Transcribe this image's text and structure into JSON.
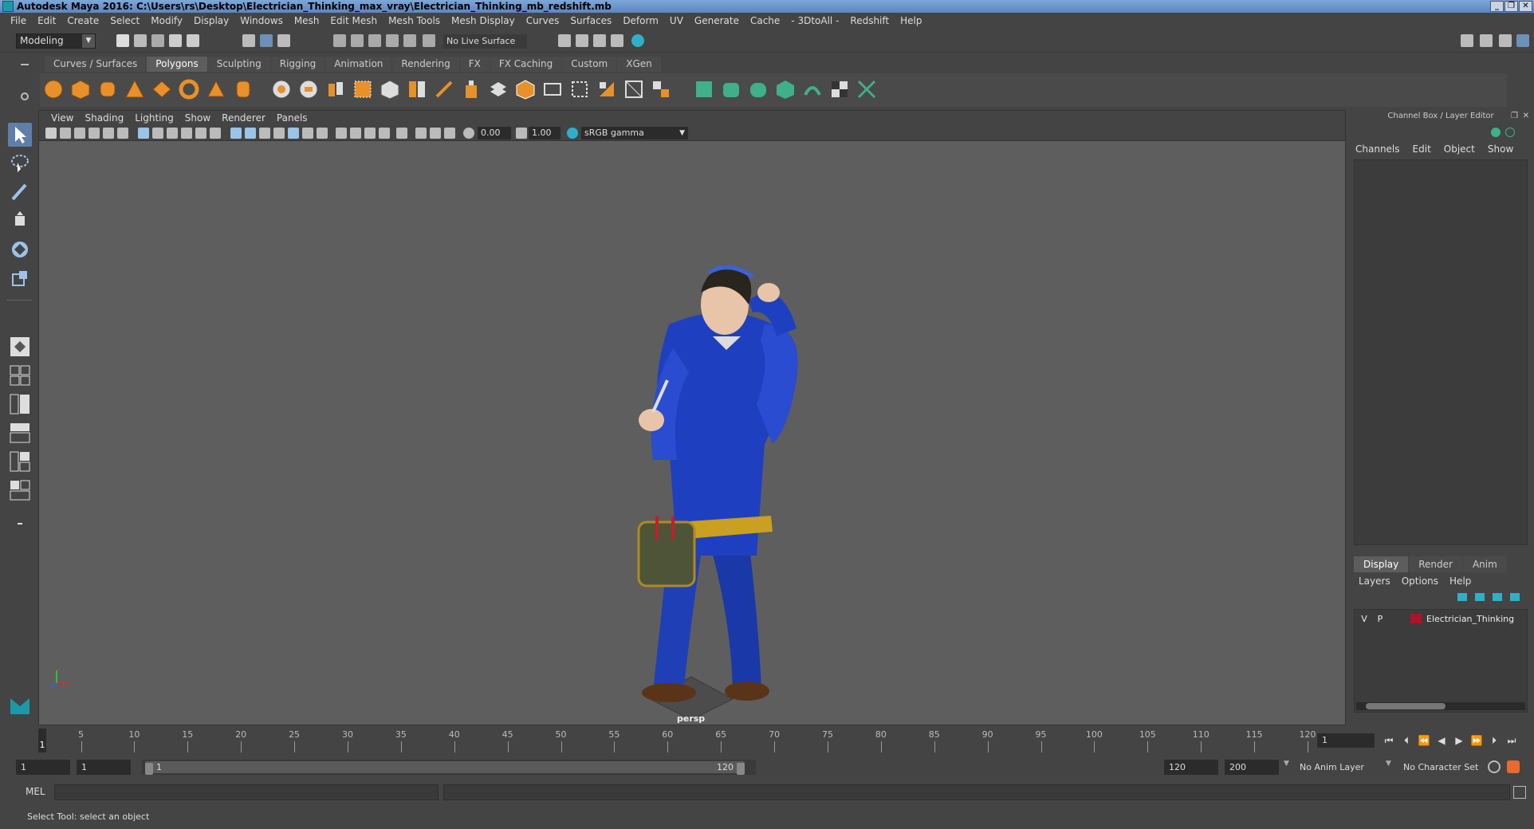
{
  "window": {
    "title": "Autodesk Maya 2016: C:\\Users\\rs\\Desktop\\Electrician_Thinking_max_vray\\Electrician_Thinking_mb_redshift.mb",
    "controls": [
      "_",
      "❐",
      "✕"
    ]
  },
  "menubar": [
    "File",
    "Edit",
    "Create",
    "Select",
    "Modify",
    "Display",
    "Windows",
    "Mesh",
    "Edit Mesh",
    "Mesh Tools",
    "Mesh Display",
    "Curves",
    "Surfaces",
    "Deform",
    "UV",
    "Generate",
    "Cache",
    "- 3DtoAll -",
    "Redshift",
    "Help"
  ],
  "statusline": {
    "mode": "Modeling",
    "live_surface": "No Live Surface"
  },
  "shelf": {
    "tabs": [
      "Curves / Surfaces",
      "Polygons",
      "Sculpting",
      "Rigging",
      "Animation",
      "Rendering",
      "FX",
      "FX Caching",
      "Custom",
      "XGen"
    ],
    "active_tab": "Polygons",
    "colors": {
      "primitive": "#e8902a",
      "tool": "#3eb08a"
    }
  },
  "viewport": {
    "menu": [
      "View",
      "Shading",
      "Lighting",
      "Show",
      "Renderer",
      "Panels"
    ],
    "exposure": "0.00",
    "gamma": "1.00",
    "colorspace": "sRGB gamma",
    "camera": "persp"
  },
  "channel_box": {
    "title": "Channel Box / Layer Editor",
    "menu": [
      "Channels",
      "Edit",
      "Object",
      "Show"
    ]
  },
  "layer_editor": {
    "tabs": [
      "Display",
      "Render",
      "Anim"
    ],
    "active_tab": "Display",
    "menu": [
      "Layers",
      "Options",
      "Help"
    ],
    "layers": [
      {
        "v": "V",
        "p": "P",
        "name": "Electrician_Thinking",
        "color": "#b0122a"
      }
    ]
  },
  "timeline": {
    "ticks": [
      "1",
      "5",
      "10",
      "15",
      "20",
      "25",
      "30",
      "35",
      "40",
      "45",
      "50",
      "55",
      "60",
      "65",
      "70",
      "75",
      "80",
      "85",
      "90",
      "95",
      "100",
      "105",
      "110",
      "115",
      "120"
    ],
    "current_frame": "1"
  },
  "range": {
    "start": "1",
    "playback_start": "1",
    "slider_start": "1",
    "slider_end": "120",
    "playback_end": "120",
    "end": "200",
    "anim_layer": "No Anim Layer",
    "character_set": "No Character Set"
  },
  "command_line": {
    "label": "MEL"
  },
  "help_line": "Select Tool: select an object"
}
